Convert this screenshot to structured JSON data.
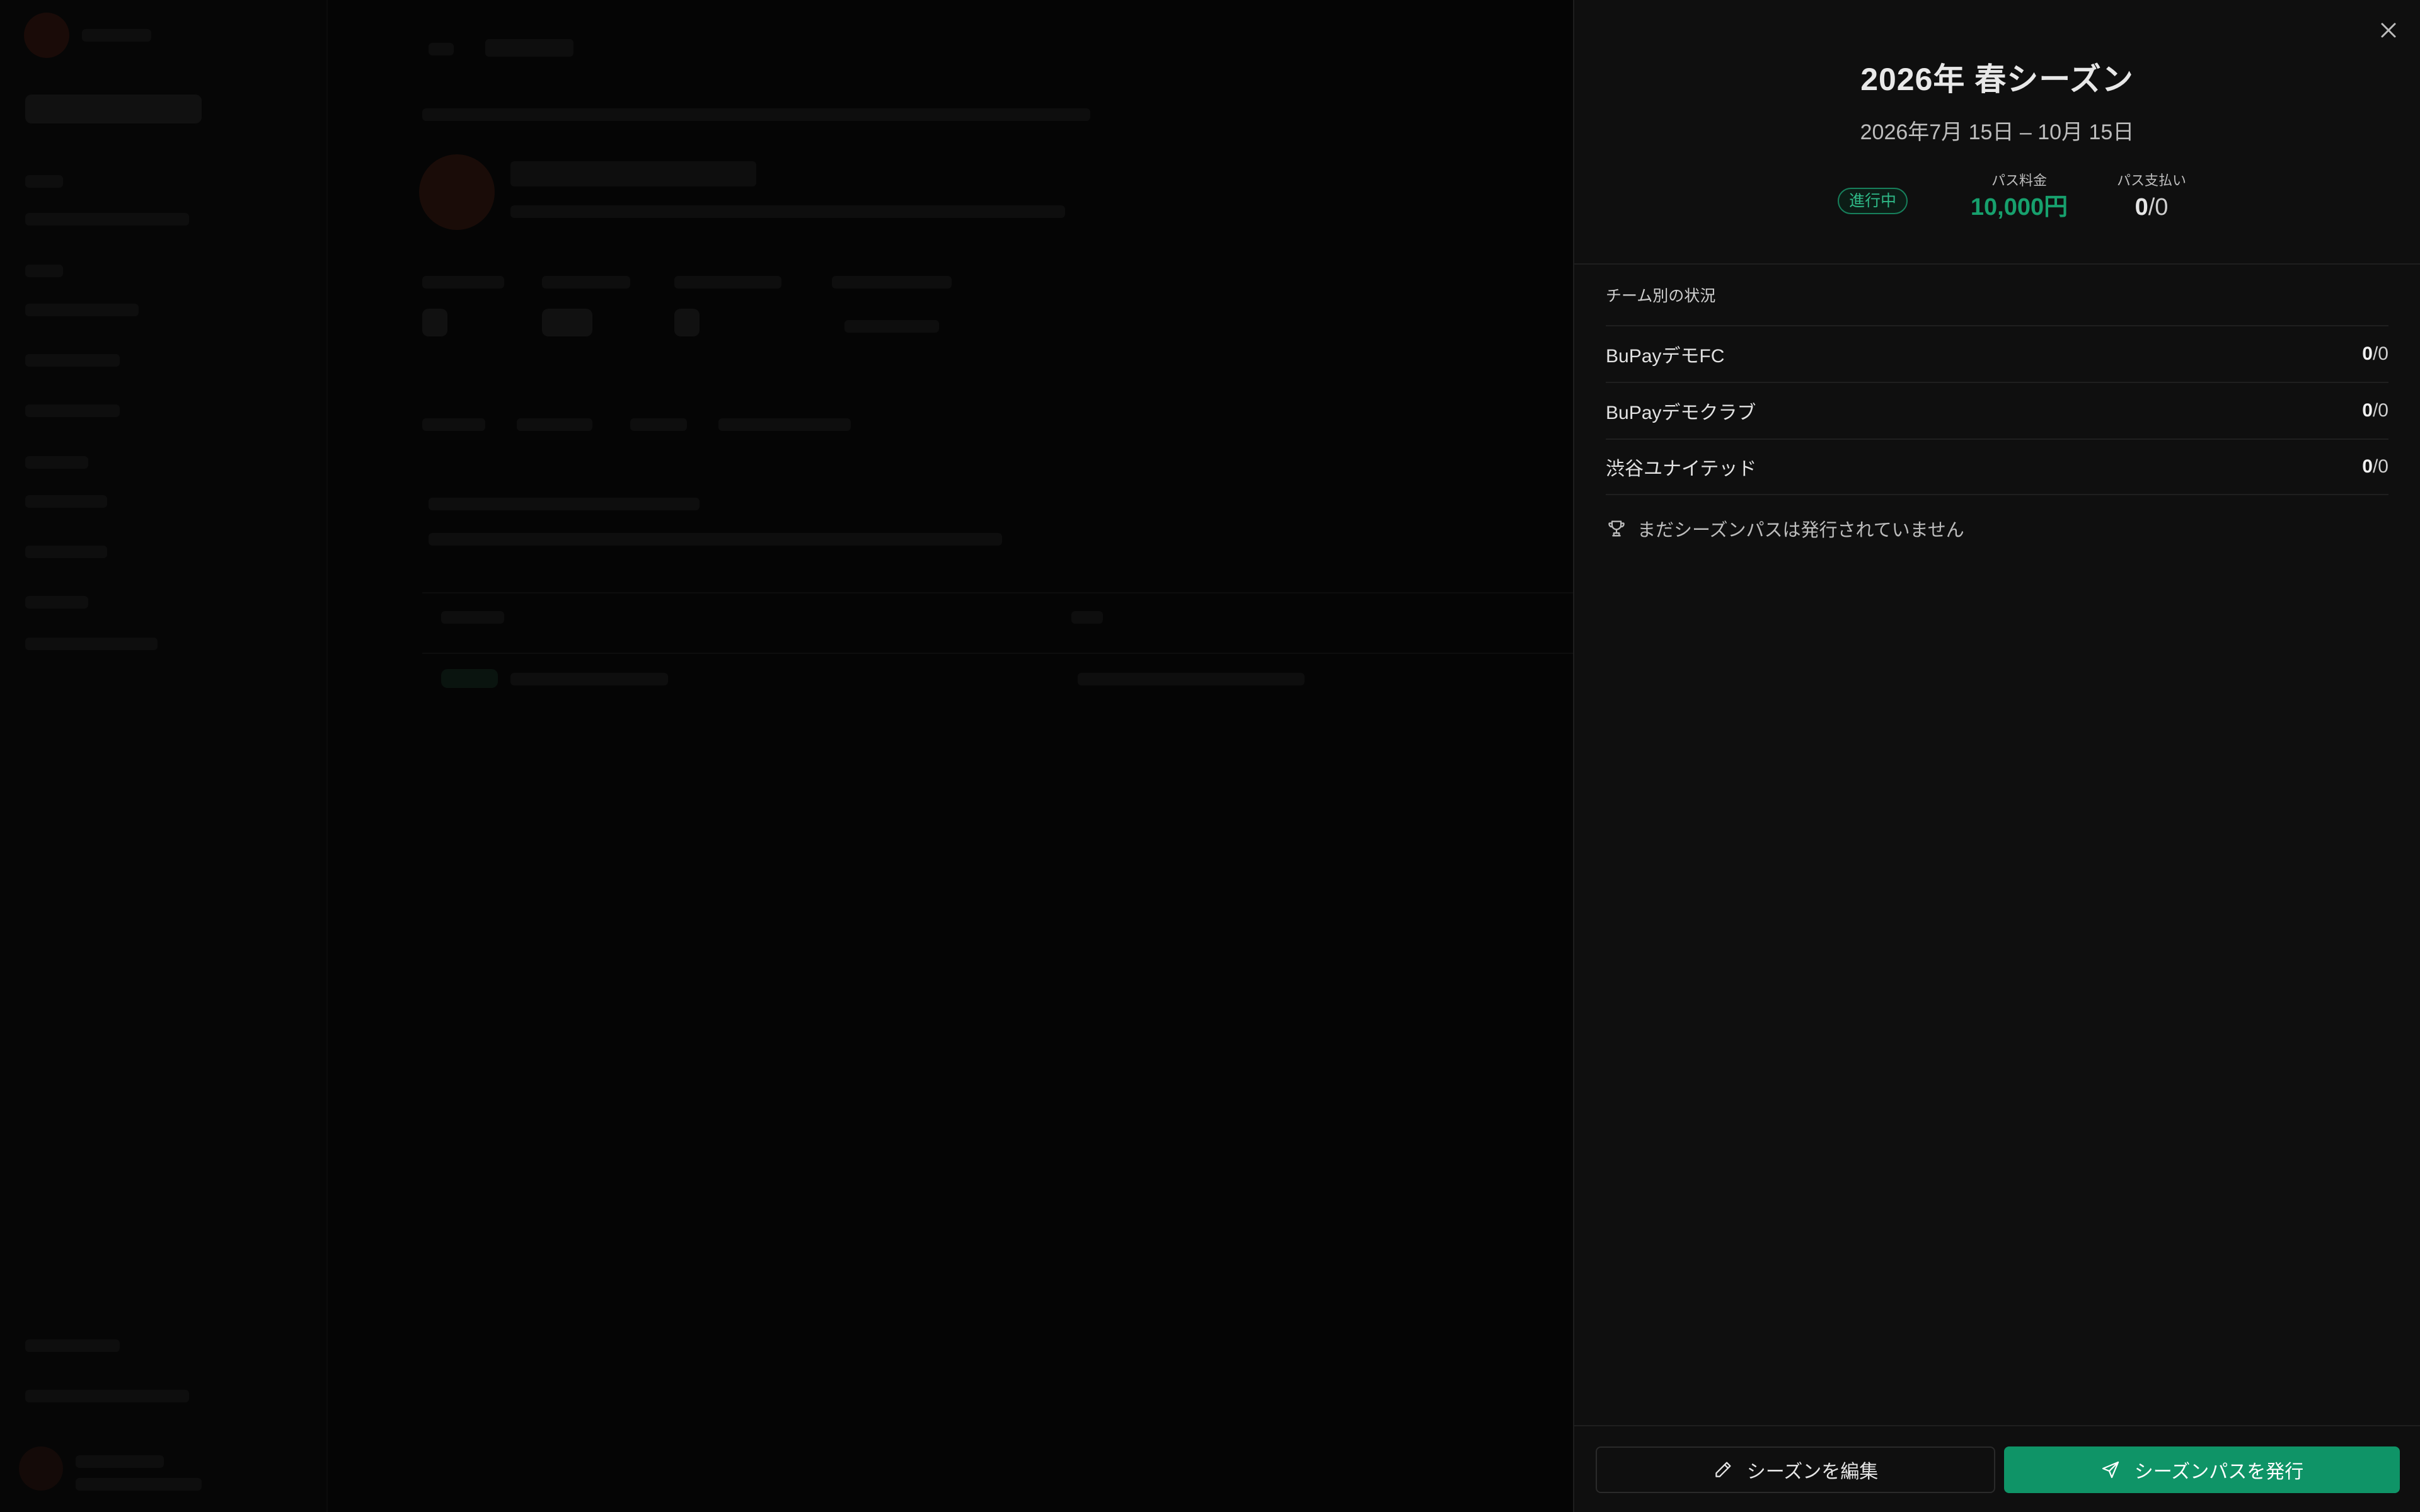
{
  "drawer": {
    "title": "2026年 春シーズン",
    "dates": "2026年7月 15日 – 10月 15日",
    "status_badge": "進行中",
    "stats": {
      "fee_label": "パス料金",
      "fee_value": "10,000円",
      "payments_label": "パス支払い",
      "payments_paid": "0",
      "payments_total": "/0"
    },
    "section_heading": "チーム別の状況",
    "teams": [
      {
        "name": "BuPayデモFC",
        "paid": "0",
        "total": "/0"
      },
      {
        "name": "BuPayデモクラブ",
        "paid": "0",
        "total": "/0"
      },
      {
        "name": "渋谷ユナイテッド",
        "paid": "0",
        "total": "/0"
      }
    ],
    "empty_note": "まだシーズンパスは発行されていません",
    "buttons": {
      "edit": "シーズンを編集",
      "issue": "シーズンパスを発行"
    }
  },
  "colors": {
    "accent": "#0f9467",
    "fee_text": "#17a06d",
    "badge_text": "#2fb886",
    "drawer_bg": "#0f0f0f"
  },
  "icons": {
    "close": "close-icon",
    "trophy": "trophy-icon",
    "pencil": "pencil-icon",
    "send": "send-icon"
  }
}
